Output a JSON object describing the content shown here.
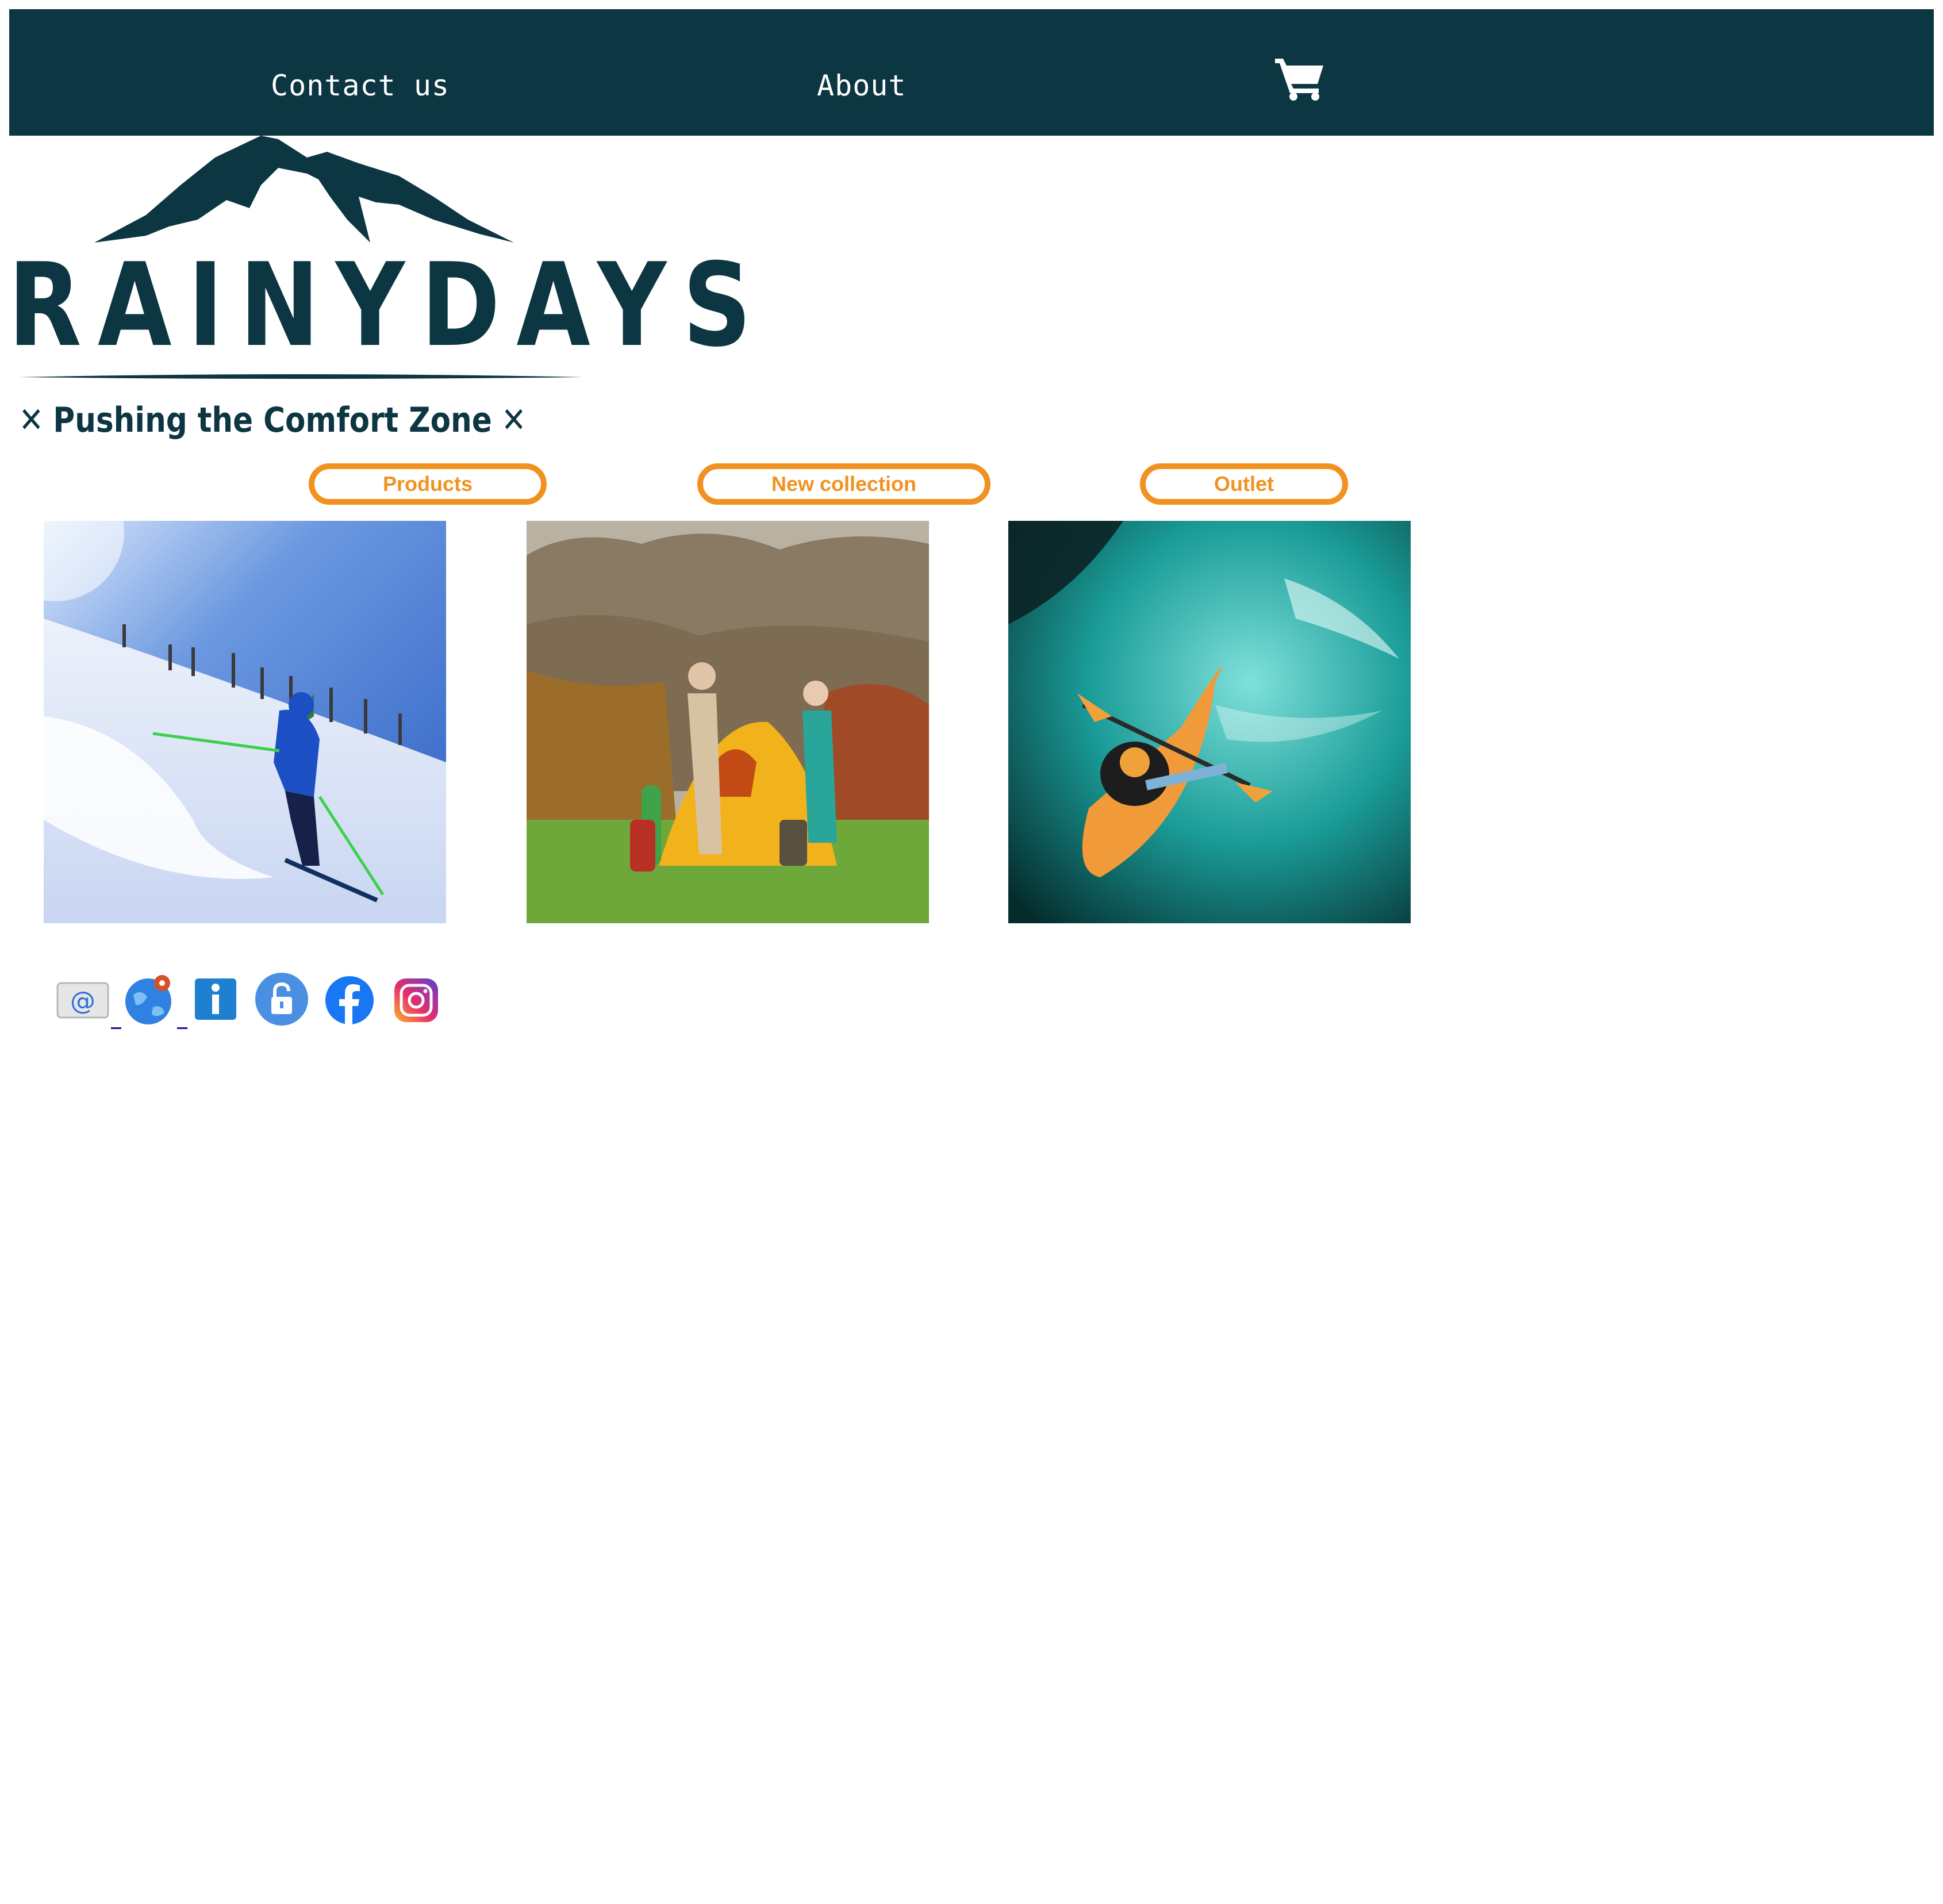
{
  "nav": {
    "contact_label": "Contact us",
    "about_label": "About",
    "cart_icon": "shopping-cart-icon",
    "background": "#0c3641"
  },
  "logo": {
    "wordmark": "RAINYDAYS",
    "tagline": "Pushing the Comfort Zone",
    "color": "#0c3641"
  },
  "categories": [
    {
      "label": "Products"
    },
    {
      "label": "New collection"
    },
    {
      "label": "Outlet"
    }
  ],
  "accent_color": "#f19220",
  "photos": [
    {
      "name": "skier-photo",
      "subject": "skier on snowy slope"
    },
    {
      "name": "camping-photo",
      "subject": "two people pitching a yellow tent"
    },
    {
      "name": "kayak-photo",
      "subject": "kayaker in turquoise water"
    }
  ],
  "footer_icons": [
    "email-icon",
    "location-globe-icon",
    "info-icon",
    "lock-icon",
    "facebook-icon",
    "instagram-icon"
  ]
}
